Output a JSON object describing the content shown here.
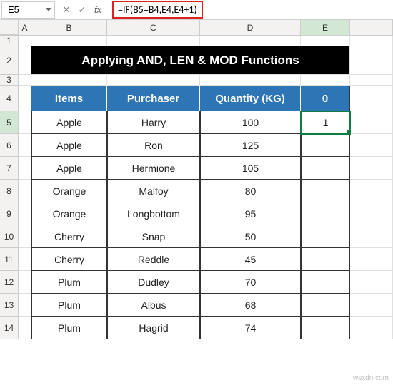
{
  "formulaBar": {
    "cellRef": "E5",
    "formula": "=IF(B5=B4,E4,E4+1)"
  },
  "columns": [
    "A",
    "B",
    "C",
    "D",
    "E"
  ],
  "rows": [
    "1",
    "2",
    "3",
    "4",
    "5",
    "6",
    "7",
    "8",
    "9",
    "10",
    "11",
    "12",
    "13",
    "14"
  ],
  "title": "Applying AND, LEN & MOD Functions",
  "headers": {
    "items": "Items",
    "purchaser": "Purchaser",
    "quantity": "Quantity (KG)",
    "e": "0"
  },
  "data": [
    {
      "item": "Apple",
      "purchaser": "Harry",
      "qty": "100",
      "e": "1"
    },
    {
      "item": "Apple",
      "purchaser": "Ron",
      "qty": "125",
      "e": ""
    },
    {
      "item": "Apple",
      "purchaser": "Hermione",
      "qty": "105",
      "e": ""
    },
    {
      "item": "Orange",
      "purchaser": "Malfoy",
      "qty": "80",
      "e": ""
    },
    {
      "item": "Orange",
      "purchaser": "Longbottom",
      "qty": "95",
      "e": ""
    },
    {
      "item": "Cherry",
      "purchaser": "Snap",
      "qty": "50",
      "e": ""
    },
    {
      "item": "Cherry",
      "purchaser": "Reddle",
      "qty": "45",
      "e": ""
    },
    {
      "item": "Plum",
      "purchaser": "Dudley",
      "qty": "70",
      "e": ""
    },
    {
      "item": "Plum",
      "purchaser": "Albus",
      "qty": "68",
      "e": ""
    },
    {
      "item": "Plum",
      "purchaser": "Hagrid",
      "qty": "74",
      "e": ""
    }
  ],
  "watermark": "wsxdn.com"
}
